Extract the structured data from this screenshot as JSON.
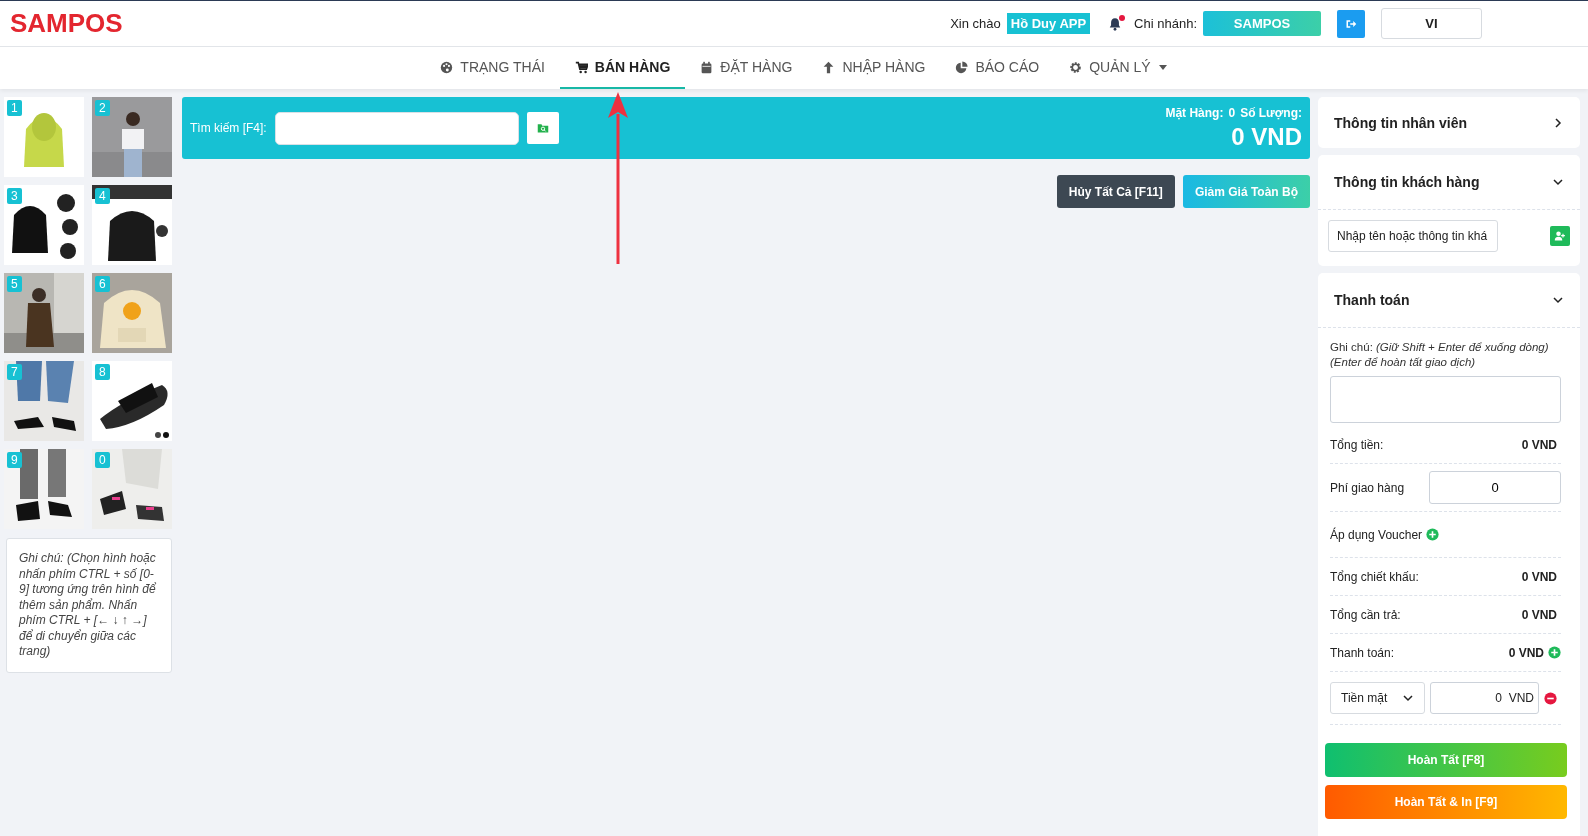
{
  "header": {
    "logo": "SAMPOS",
    "greeting": "Xin chào",
    "user": "Hồ Duy APP",
    "branch_label": "Chi nhánh:",
    "branch": "SAMPOS",
    "notification_dot": true,
    "language": "VI"
  },
  "tabs": [
    {
      "label": "TRẠNG THÁI",
      "selected": false
    },
    {
      "label": "BÁN HÀNG",
      "selected": true
    },
    {
      "label": "ĐẶT HÀNG",
      "selected": false
    },
    {
      "label": "NHẬP HÀNG",
      "selected": false
    },
    {
      "label": "BÁO CÁO",
      "selected": false
    },
    {
      "label": "QUẢN LÝ",
      "selected": false,
      "dropdown": true
    }
  ],
  "products": [
    {
      "key": "1",
      "kind": "picture"
    },
    {
      "key": "2",
      "kind": "picture"
    },
    {
      "key": "3",
      "kind": "picture"
    },
    {
      "key": "4",
      "kind": "picture"
    },
    {
      "key": "5",
      "kind": "picture"
    },
    {
      "key": "6",
      "kind": "picture"
    },
    {
      "key": "7",
      "kind": "picture"
    },
    {
      "key": "8",
      "kind": "picture"
    },
    {
      "key": "9",
      "kind": "picture"
    },
    {
      "key": "0",
      "kind": "picture"
    }
  ],
  "products_note": "Ghi chú: (Chọn hình hoặc nhấn phím CTRL + số [0-9] tương ứng trên hình để thêm sản phẩm. Nhấn phím CTRL + [← ↓ ↑ →] để di chuyển giữa các trang)",
  "search": {
    "label": "Tìm kiếm [F4]:",
    "items_label": "Mặt Hàng:",
    "items_count": "0",
    "quantity_label": "Số Lượng:",
    "total": "0 VND"
  },
  "actions": [
    {
      "label": "Hủy Tất Cả [F11]",
      "kind": "dark"
    },
    {
      "label": "Giảm Giá Toàn Bộ",
      "kind": "gradient"
    }
  ],
  "staff_panel": {
    "title": "Thông tin nhân viên",
    "expanded": false
  },
  "customer_panel": {
    "title": "Thông tin khách hàng",
    "expanded": true,
    "placeholder": "Nhập tên hoặc thông tin khá"
  },
  "payment_panel": {
    "title": "Thanh toán",
    "expanded": true,
    "note_label": "Ghi chú:",
    "note_hint": "(Giữ Shift + Enter để xuống dòng) (Enter để hoàn tất giao dịch)",
    "rows": [
      {
        "kind": "total",
        "label": "Tổng tiền:",
        "value": "0 VND"
      },
      {
        "kind": "input",
        "label": "Phí giao hàng",
        "value": "0"
      },
      {
        "kind": "voucher",
        "label": "Áp dụng Voucher"
      },
      {
        "kind": "total",
        "label": "Tổng chiết khấu:",
        "value": "0 VND"
      },
      {
        "kind": "total",
        "label": "Tổng cần trả:",
        "value": "0 VND"
      },
      {
        "kind": "payment",
        "label": "Thanh toán:",
        "value": "0 VND"
      }
    ],
    "method": {
      "select": "Tiền mặt",
      "amount": "0",
      "unit": "VND"
    },
    "buttons": [
      {
        "label": "Hoàn Tất [F8]",
        "kind": "green"
      },
      {
        "label": "Hoàn Tất & In [F9]",
        "kind": "orange"
      }
    ]
  }
}
